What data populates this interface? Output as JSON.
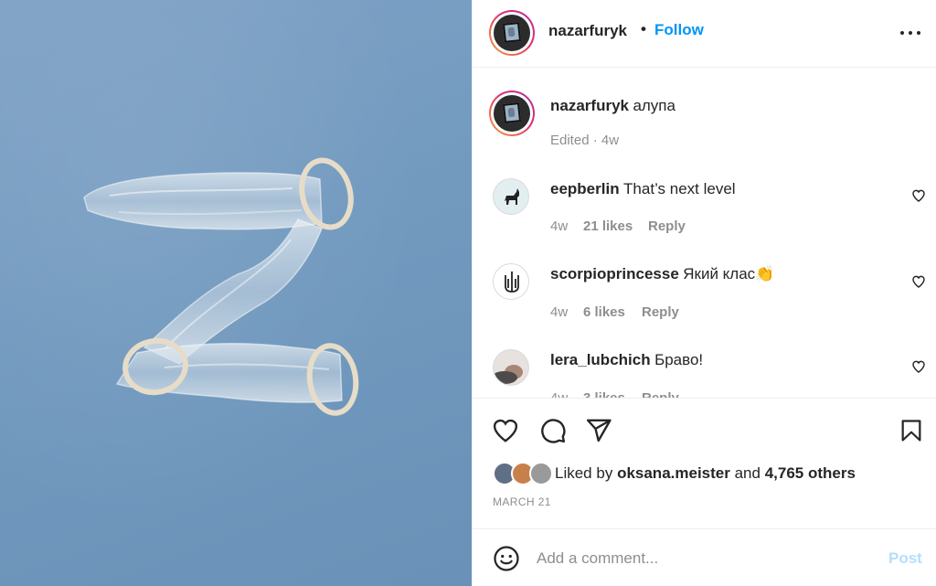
{
  "post": {
    "username": "nazarfuryk",
    "separator": "•",
    "follow_label": "Follow",
    "caption_user": "nazarfuryk",
    "caption_text": "алупа",
    "caption_meta": "Edited · 4w"
  },
  "comments": [
    {
      "user": "eepberlin",
      "text": "That’s next level",
      "age": "4w",
      "likes": "21 likes",
      "reply": "Reply"
    },
    {
      "user": "scorpioprincesse",
      "text": "Який клас👏",
      "age": "4w",
      "likes": "6 likes",
      "reply": "Reply"
    },
    {
      "user": "lera_lubchich",
      "text": "Браво!",
      "age": "4w",
      "likes": "3 likes",
      "reply": "Reply"
    }
  ],
  "likes": {
    "prefix": "Liked by",
    "user": "oksana.meister",
    "middle": "and",
    "others": "4,765 others"
  },
  "date": "MARCH 21",
  "comment_box": {
    "placeholder": "Add a comment...",
    "post_label": "Post"
  },
  "icons": {
    "like": "heart-icon",
    "comment": "comment-icon",
    "share": "paper-plane-icon",
    "save": "bookmark-icon",
    "emoji": "smiley-icon",
    "more": "more-dots-icon"
  },
  "colors": {
    "accent": "#0095f6",
    "post_disabled": "#b2dffc",
    "muted": "#8e8e8e",
    "photo_background": "#729abf"
  }
}
